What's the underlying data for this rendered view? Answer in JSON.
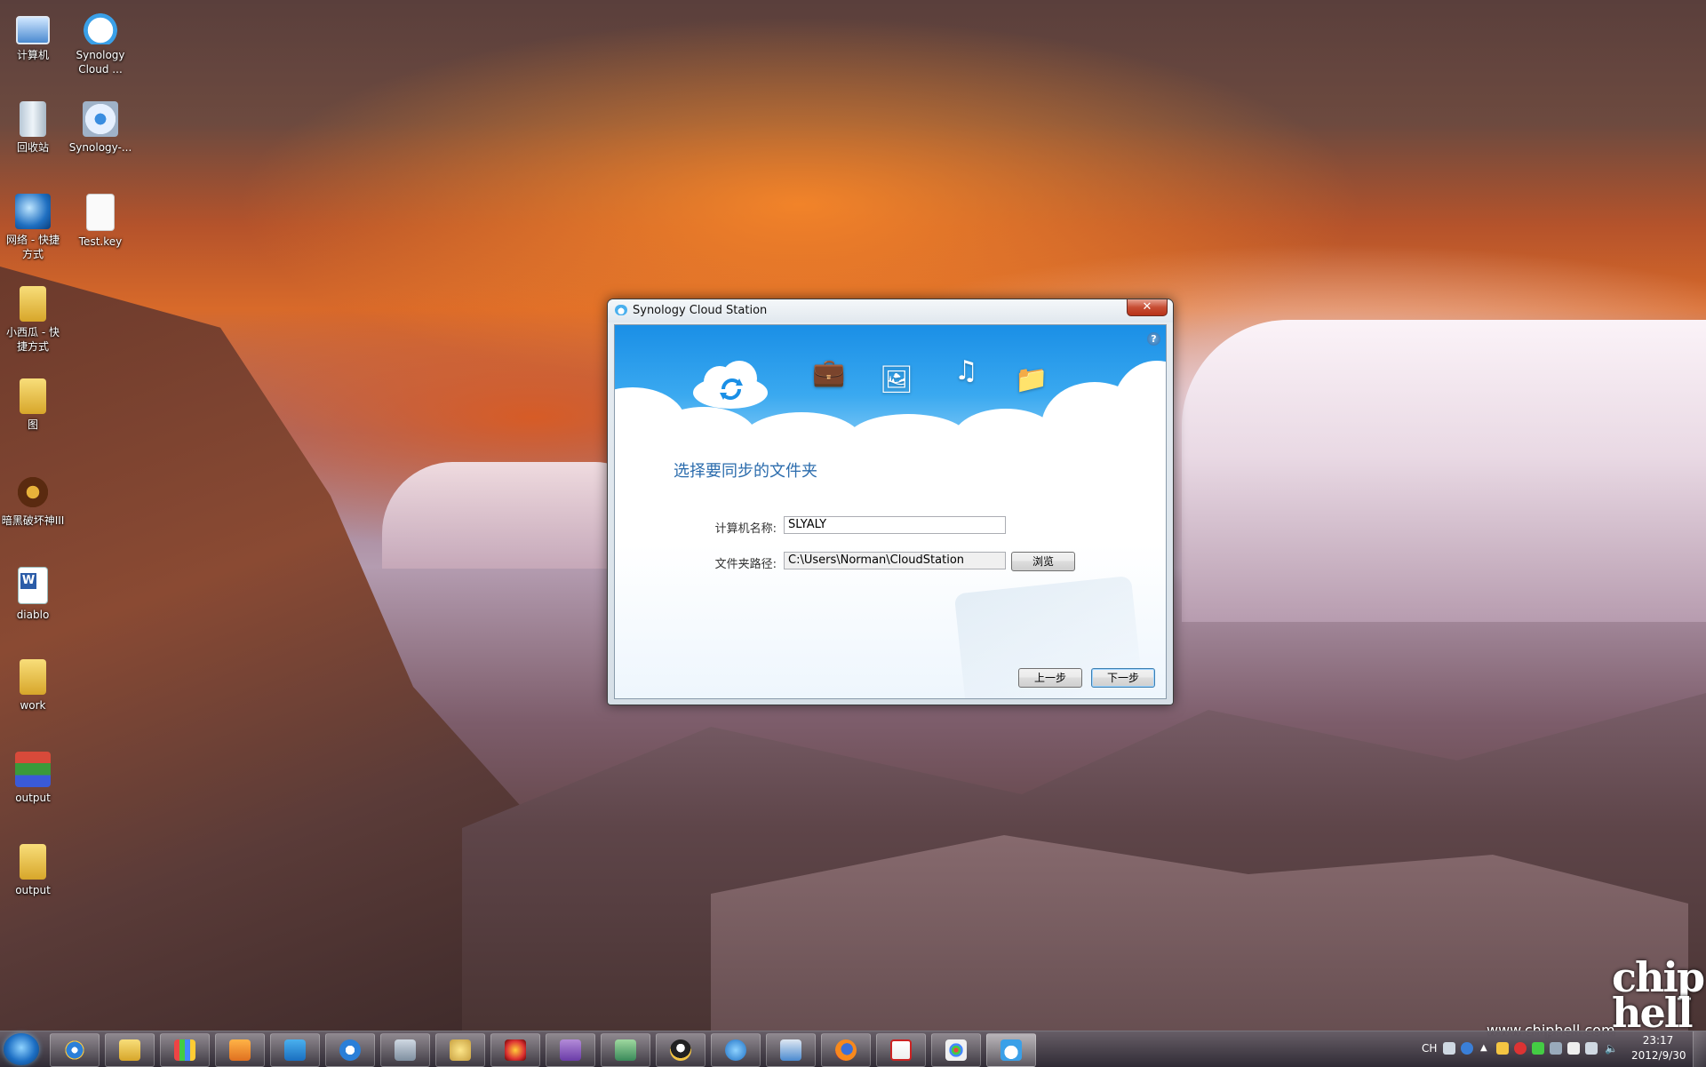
{
  "desktop_icons": [
    {
      "label": "计算机",
      "icon": "computer-icon"
    },
    {
      "label": "Synology Cloud ...",
      "icon": "cloud-station-icon"
    },
    {
      "label": "回收站",
      "icon": "recycle-bin-icon"
    },
    {
      "label": "Synology-...",
      "icon": "installer-disc-icon"
    },
    {
      "label": "网络 - 快捷方式",
      "icon": "network-icon"
    },
    {
      "label": "Test.key",
      "icon": "file-icon"
    },
    {
      "label": "小西瓜 - 快捷方式",
      "icon": "folder-shortcut-icon"
    },
    {
      "label": "图",
      "icon": "folder-icon"
    },
    {
      "label": "暗黑破坏神III",
      "icon": "diablo-icon"
    },
    {
      "label": "diablo",
      "icon": "word-document-icon"
    },
    {
      "label": "work",
      "icon": "folder-icon"
    },
    {
      "label": "output",
      "icon": "winrar-archive-icon"
    },
    {
      "label": "output",
      "icon": "folder-icon"
    }
  ],
  "dialog": {
    "title": "Synology Cloud Station",
    "close_glyph": "✕",
    "help_glyph": "?",
    "heading": "选择要同步的文件夹",
    "computer_name_label": "计算机名称:",
    "computer_name_value": "SLYALY",
    "folder_path_label": "文件夹路径:",
    "folder_path_value": "C:\\Users\\Norman\\CloudStation",
    "browse_label": "浏览",
    "back_label": "上一步",
    "next_label": "下一步",
    "banner_icons": [
      "cloud-sync-icon",
      "briefcase-icon",
      "photos-icon",
      "music-icon",
      "documents-icon"
    ]
  },
  "taskbar": {
    "pinned": [
      "internet-explorer-icon",
      "explorer-folder-icon",
      "pencils-icon",
      "media-center-icon",
      "synology-assistant-icon",
      "media-player-icon",
      "network-drive-icon",
      "games-icon",
      "flash-app-icon",
      "cpu-z-icon",
      "photo-viewer-icon",
      "qq-icon",
      "cloud-icon",
      "remote-desktop-icon",
      "firefox-icon",
      "acrobat-icon",
      "paint-icon",
      "cloud-station-icon"
    ],
    "ime": "CH",
    "clock_time": "23:17",
    "clock_date": "2012/9/30"
  },
  "watermark": {
    "url": "www.chiphell.com",
    "logo": "chip hell"
  },
  "colors": {
    "banner_blue": "#1a8fe6",
    "heading_blue": "#2b6cad",
    "close_red": "#c74d33"
  }
}
